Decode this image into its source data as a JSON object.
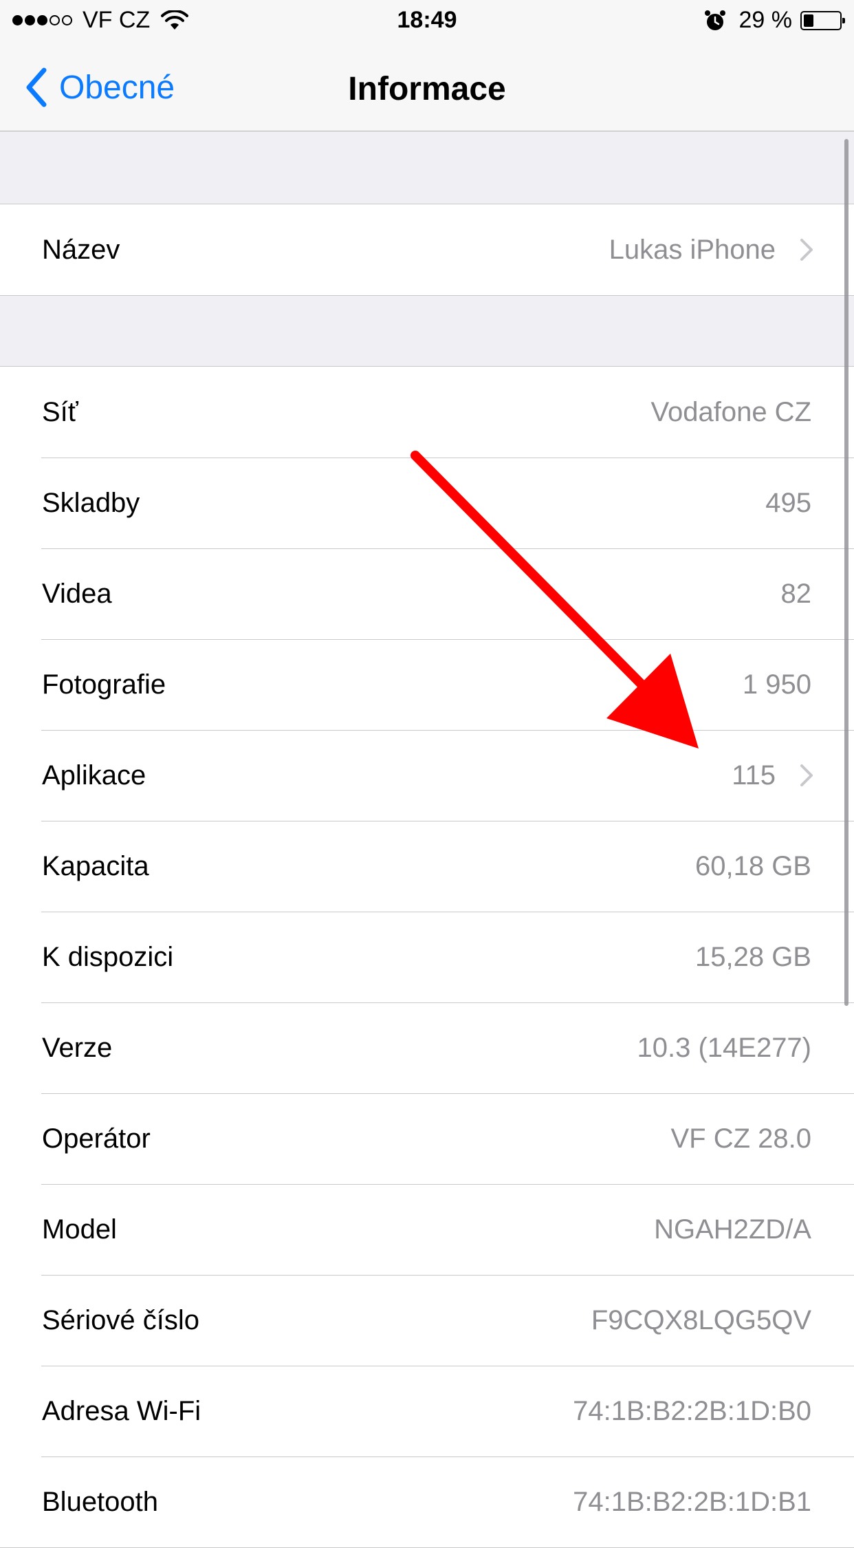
{
  "status_bar": {
    "signal_dots": [
      "full",
      "full",
      "full",
      "empty",
      "empty"
    ],
    "carrier": "VF CZ",
    "time": "18:49",
    "battery_percent": "29 %",
    "battery_level": 0.29,
    "icons": [
      "wifi-icon",
      "alarm-icon",
      "battery-icon"
    ]
  },
  "nav": {
    "back_label": "Obecné",
    "title": "Informace",
    "accent_color": "#0a7aff"
  },
  "name_group": {
    "rows": [
      {
        "label": "Název",
        "value": "Lukas iPhone",
        "chevron": true
      }
    ]
  },
  "info_group": {
    "rows": [
      {
        "label": "Síť",
        "value": "Vodafone CZ",
        "chevron": false
      },
      {
        "label": "Skladby",
        "value": "495",
        "chevron": false
      },
      {
        "label": "Videa",
        "value": "82",
        "chevron": false
      },
      {
        "label": "Fotografie",
        "value": "1 950",
        "chevron": false
      },
      {
        "label": "Aplikace",
        "value": "115",
        "chevron": true
      },
      {
        "label": "Kapacita",
        "value": "60,18 GB",
        "chevron": false
      },
      {
        "label": "K dispozici",
        "value": "15,28 GB",
        "chevron": false
      },
      {
        "label": "Verze",
        "value": "10.3 (14E277)",
        "chevron": false
      },
      {
        "label": "Operátor",
        "value": "VF CZ 28.0",
        "chevron": false
      },
      {
        "label": "Model",
        "value": "NGAH2ZD/A",
        "chevron": false
      },
      {
        "label": "Sériové číslo",
        "value": "F9CQX8LQG5QV",
        "chevron": false
      },
      {
        "label": "Adresa Wi-Fi",
        "value": "74:1B:B2:2B:1D:B0",
        "chevron": false
      },
      {
        "label": "Bluetooth",
        "value": "74:1B:B2:2B:1D:B1",
        "chevron": false
      }
    ]
  },
  "annotation": {
    "color": "#ff0000",
    "points_to": "Aplikace"
  }
}
